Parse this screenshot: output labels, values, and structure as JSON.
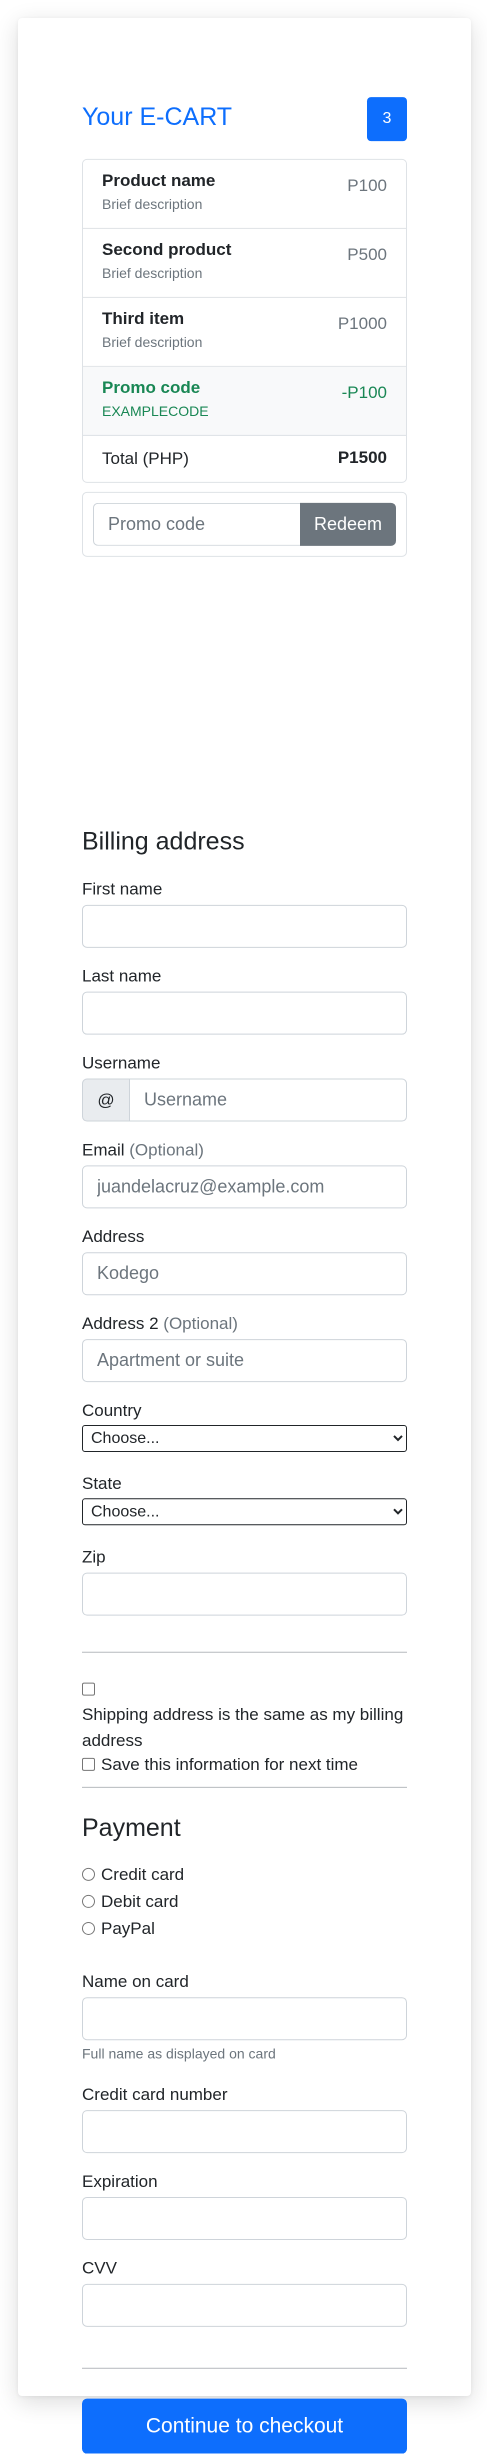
{
  "cart": {
    "title": "Your E-CART",
    "count": "3",
    "items": [
      {
        "name": "Product name",
        "desc": "Brief description",
        "price": "P100"
      },
      {
        "name": "Second product",
        "desc": "Brief description",
        "price": "P500"
      },
      {
        "name": "Third item",
        "desc": "Brief description",
        "price": "P1000"
      }
    ],
    "promo": {
      "name": "Promo code",
      "code": "EXAMPLECODE",
      "price": "-P100"
    },
    "total_label": "Total (PHP)",
    "total_value": "P1500",
    "promo_placeholder": "Promo code",
    "redeem_label": "Redeem"
  },
  "billing": {
    "title": "Billing address",
    "first_name_label": "First name",
    "first_name_value": "",
    "last_name_label": "Last name",
    "last_name_value": "",
    "username_label": "Username",
    "username_addon": "@",
    "username_placeholder": "Username",
    "email_label": "Email",
    "email_optional": "(Optional)",
    "email_placeholder": "juandelacruz@example.com",
    "address_label": "Address",
    "address_placeholder": "Kodego",
    "address2_label": "Address 2",
    "address2_optional": "(Optional)",
    "address2_placeholder": "Apartment or suite",
    "country_label": "Country",
    "country_selected": "Choose...",
    "state_label": "State",
    "state_selected": "Choose...",
    "zip_label": "Zip",
    "zip_value": "",
    "same_address_label": "Shipping address is the same as my billing address",
    "save_info_label": "Save this information for next time"
  },
  "payment": {
    "title": "Payment",
    "methods": [
      "Credit card",
      "Debit card",
      "PayPal"
    ],
    "name_label": "Name on card",
    "name_help": "Full name as displayed on card",
    "number_label": "Credit card number",
    "expiration_label": "Expiration",
    "cvv_label": "CVV",
    "checkout_label": "Continue to checkout"
  },
  "colors": {
    "primary": "#0d6efd",
    "success": "#198754",
    "secondary": "#6c757d"
  }
}
